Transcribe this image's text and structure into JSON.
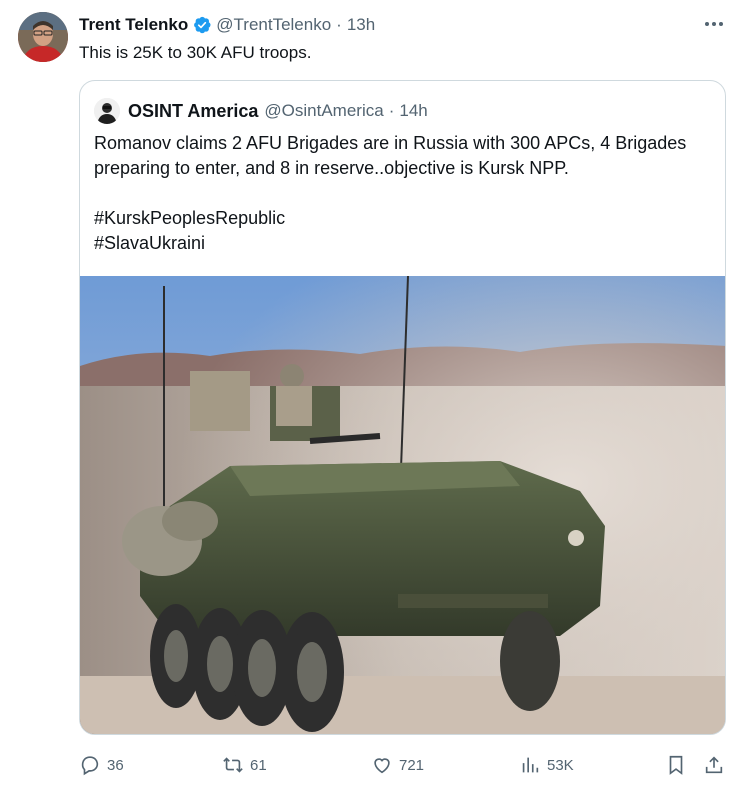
{
  "author": {
    "name": "Trent Telenko",
    "handle": "@TrentTelenko",
    "separator": "·",
    "time": "13h",
    "verified": true
  },
  "tweet": {
    "text": "This is 25K to 30K AFU troops."
  },
  "quote": {
    "name": "OSINT America",
    "handle": "@OsintAmerica",
    "separator": "·",
    "time": "14h",
    "text": "Romanov claims 2 AFU Brigades are in Russia with 300 APCs, 4 Brigades preparing to enter, and 8 in reserve..objective is Kursk NPP.\n\n#KurskPeoplesRepublic\n#SlavaUkraini",
    "media": "armored-vehicle-photo"
  },
  "actions": {
    "reply_count": "36",
    "retweet_count": "61",
    "like_count": "721",
    "view_count": "53K"
  },
  "colors": {
    "verified": "#1d9bf0",
    "secondary_text": "#536471",
    "border": "#cfd9de"
  }
}
